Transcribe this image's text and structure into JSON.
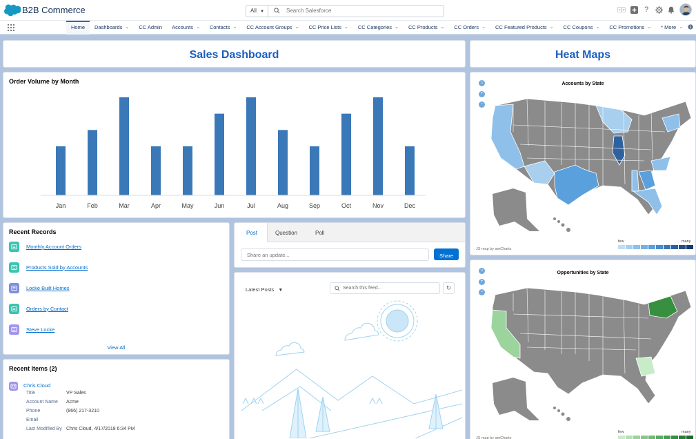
{
  "header": {
    "app_name": "B2B Commerce",
    "search_scope": "All",
    "search_placeholder": "Search Salesforce"
  },
  "nav": {
    "items": [
      {
        "label": "Home",
        "active": true,
        "caret": false
      },
      {
        "label": "Dashboards",
        "caret": true
      },
      {
        "label": "CC Admin",
        "caret": false
      },
      {
        "label": "Accounts",
        "caret": true
      },
      {
        "label": "Contacts",
        "caret": true
      },
      {
        "label": "CC Account Groups",
        "caret": true
      },
      {
        "label": "CC Price Lists",
        "caret": true
      },
      {
        "label": "CC Categories",
        "caret": true
      },
      {
        "label": "CC Products",
        "caret": true
      },
      {
        "label": "CC Orders",
        "caret": true
      },
      {
        "label": "CC Featured Products",
        "caret": true
      },
      {
        "label": "CC Coupons",
        "caret": true
      },
      {
        "label": "CC Promotions",
        "caret": true
      },
      {
        "label": "* More",
        "caret": true
      }
    ]
  },
  "sales_dashboard": {
    "title": "Sales Dashboard"
  },
  "heat_maps": {
    "title": "Heat Maps",
    "map1_title": "Accounts by State",
    "map2_title": "Opportunities by State",
    "credit": "JS map by amCharts",
    "legend_few": "few",
    "legend_many": "many",
    "map1_colors": [
      "#c2ddf1",
      "#a8cfee",
      "#8ec0ea",
      "#74b0e3",
      "#5aa0dc",
      "#4a8bc9",
      "#3b76b4",
      "#2e629e",
      "#224f88",
      "#163c70"
    ],
    "map2_colors": [
      "#c8ecc8",
      "#b2e0b2",
      "#9bd49c",
      "#84c887",
      "#6dbb72",
      "#58ae60",
      "#44a04f",
      "#36903f",
      "#287f31",
      "#1b6e24"
    ]
  },
  "chart_data": {
    "type": "bar",
    "title": "Order Volume by Month",
    "categories": [
      "Jan",
      "Feb",
      "Mar",
      "Apr",
      "May",
      "Jun",
      "Jul",
      "Aug",
      "Sep",
      "Oct",
      "Nov",
      "Dec"
    ],
    "values": [
      3,
      4,
      6,
      3,
      3,
      5,
      6,
      4,
      3,
      5,
      6,
      3
    ],
    "ylim": [
      0,
      6
    ],
    "grid": false,
    "bar_color": "#3a78b8"
  },
  "recent_records": {
    "title": "Recent Records",
    "items": [
      {
        "label": "Monthly Account Orders",
        "icon": "report-icon",
        "color": "#3bc4b0"
      },
      {
        "label": "Products Sold by Accounts",
        "icon": "report-icon",
        "color": "#3bc4b0"
      },
      {
        "label": "Locke Built Homes",
        "icon": "account-icon",
        "color": "#7f8de1"
      },
      {
        "label": "Orders by Contact",
        "icon": "report-icon",
        "color": "#3bc4b0"
      },
      {
        "label": "Steve Locke",
        "icon": "contact-icon",
        "color": "#a094ed"
      }
    ],
    "view_all": "View All"
  },
  "recent_items": {
    "title": "Recent Items (2)",
    "name": "Chris Cloud",
    "fields": [
      {
        "label": "Title",
        "value": "VP Sales"
      },
      {
        "label": "Account Name",
        "value": "Acme"
      },
      {
        "label": "Phone",
        "value": "(866) 217-3210"
      },
      {
        "label": "Email",
        "value": ""
      },
      {
        "label": "Last Modified By",
        "value": "Chris Cloud, 4/17/2018 6:34 PM"
      }
    ]
  },
  "publisher": {
    "tabs": [
      "Post",
      "Question",
      "Poll"
    ],
    "share_placeholder": "Share an update...",
    "share_button": "Share"
  },
  "feed": {
    "filter_label": "Latest Posts",
    "search_placeholder": "Search this feed..."
  }
}
